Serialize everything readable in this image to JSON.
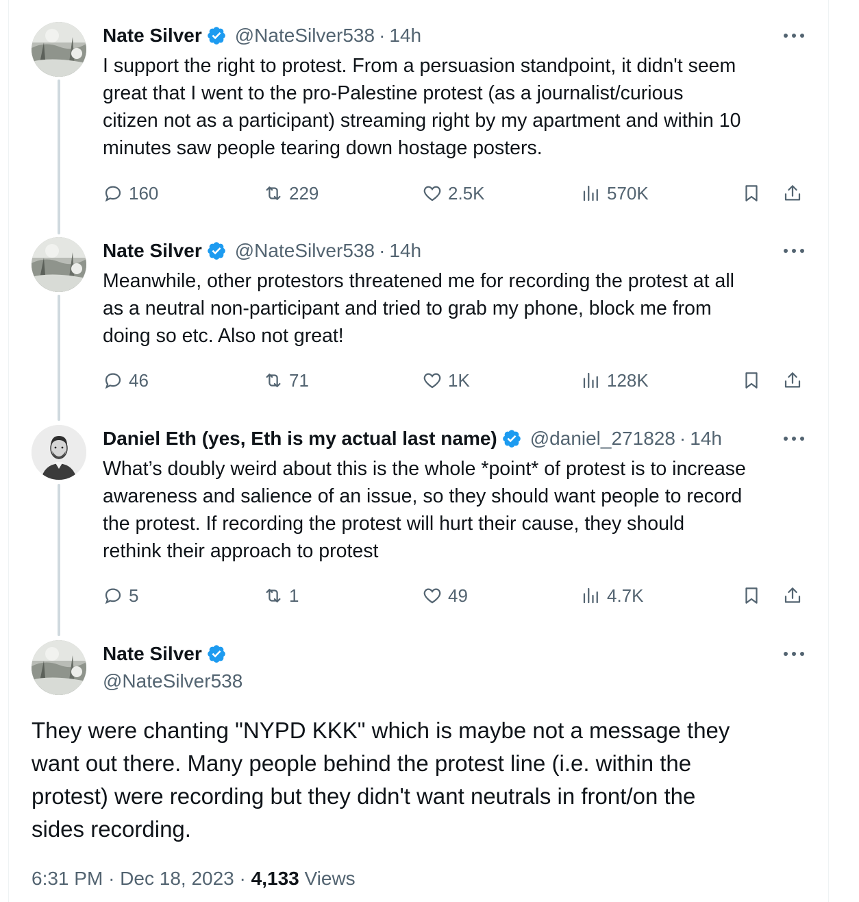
{
  "tweets": [
    {
      "name": "Nate Silver",
      "handle": "@NateSilver538",
      "time": "14h",
      "text": "I support the right to protest. From a persuasion standpoint, it didn't seem\ngreat that I went to the pro-Palestine protest (as a journalist/curious\ncitizen not as a participant) streaming right by my apartment and within 10\nminutes saw people tearing down hostage posters.",
      "replies": "160",
      "reposts": "229",
      "likes": "2.5K",
      "views": "570K"
    },
    {
      "name": "Nate Silver",
      "handle": "@NateSilver538",
      "time": "14h",
      "text": "Meanwhile, other protestors threatened me for recording the protest at all\nas a neutral non-participant and tried to grab my phone, block me from\ndoing so etc. Also not great!",
      "replies": "46",
      "reposts": "71",
      "likes": "1K",
      "views": "128K"
    },
    {
      "name": "Daniel Eth (yes, Eth is my actual last name)",
      "handle": "@daniel_271828",
      "time": "14h",
      "text": "What’s doubly weird about this is the whole *point* of protest is to increase\nawareness and salience of an issue, so they should want people to record\nthe protest. If recording the protest will hurt their cause, they should\nrethink their approach to protest",
      "replies": "5",
      "reposts": "1",
      "likes": "49",
      "views": "4.7K"
    }
  ],
  "main_tweet": {
    "name": "Nate Silver",
    "handle": "@NateSilver538",
    "text": "They were chanting \"NYPD KKK\" which is maybe not a message they\nwant out there. Many people behind the protest line (i.e. within the\nprotest) were recording but they didn't want neutrals in front/on the\nsides recording.",
    "time": "6:31 PM",
    "date": "Dec 18, 2023",
    "views_count": "4,133",
    "views_label": "Views"
  },
  "separator": "·",
  "colors": {
    "text": "#0f1419",
    "muted": "#536471",
    "verified": "#1d9bf0",
    "thread_line": "#cfd9de"
  },
  "icons": [
    "verified-badge-icon",
    "more-icon",
    "reply-icon",
    "repost-icon",
    "like-icon",
    "views-icon",
    "bookmark-icon",
    "share-icon"
  ]
}
